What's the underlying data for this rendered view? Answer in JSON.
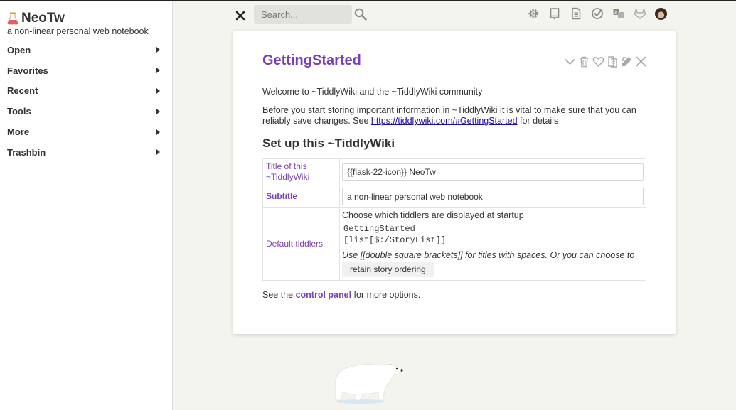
{
  "sidebar": {
    "title": "NeoTw",
    "subtitle": "a non-linear personal web notebook",
    "items": [
      {
        "label": "Open"
      },
      {
        "label": "Favorites"
      },
      {
        "label": "Recent"
      },
      {
        "label": "Tools"
      },
      {
        "label": "More"
      },
      {
        "label": "Trashbin"
      }
    ]
  },
  "toolbar": {
    "search_placeholder": "Search..."
  },
  "tiddler": {
    "title": "GettingStarted",
    "welcome": "Welcome to ~TiddlyWiki and the ~TiddlyWiki community",
    "intro_before": "Before you start storing important information in ~TiddlyWiki it is vital to make sure that you can reliably save changes. See ",
    "intro_link": "https://tiddlywiki.com/#GettingStarted",
    "intro_after": " for details",
    "setup_heading": "Set up this ~TiddlyWiki",
    "rows": {
      "title_label": "Title of this ~TiddlyWiki",
      "title_value": "{{flask-22-icon}} NeoTw",
      "subtitle_label": "Subtitle",
      "subtitle_value": "a non-linear personal web notebook",
      "default_label": "Default tiddlers",
      "default_desc": "Choose which tiddlers are displayed at startup",
      "default_line1": "GettingStarted",
      "default_line2": "[list[$:/StoryList]]",
      "default_hint": "Use [[double square brackets]] for titles with spaces. Or you can choose to",
      "retain_button": "retain story ordering"
    },
    "footer_before": "See the ",
    "footer_link": "control panel",
    "footer_after": " for more options."
  },
  "colors": {
    "accent": "#7a3fb5",
    "link": "#1a0dab",
    "background": "#f4f4ee"
  }
}
